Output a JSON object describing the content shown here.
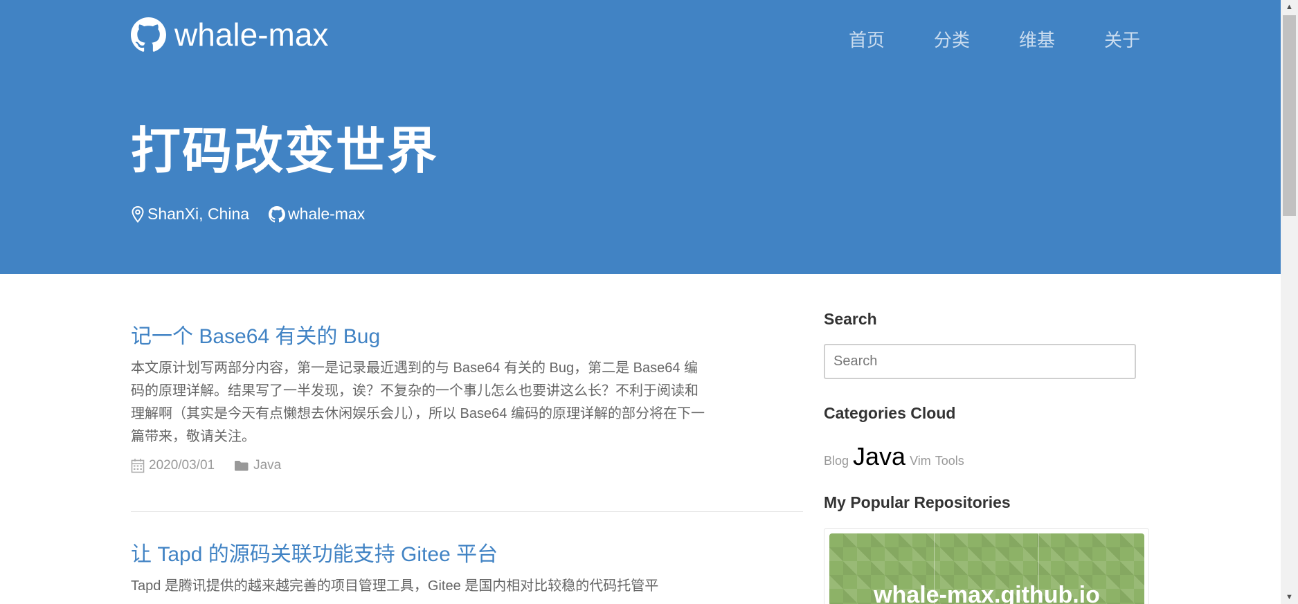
{
  "header": {
    "brand": "whale-max",
    "nav": [
      "首页",
      "分类",
      "维基",
      "关于"
    ],
    "title": "打码改变世界",
    "location": "ShanXi, China",
    "github_user": "whale-max"
  },
  "posts": [
    {
      "title": "记一个 Base64 有关的 Bug",
      "excerpt": "本文原计划写两部分内容，第一是记录最近遇到的与 Base64 有关的 Bug，第二是 Base64 编码的原理详解。结果写了一半发现，诶？不复杂的一个事儿怎么也要讲这么长？不利于阅读和理解啊（其实是今天有点懒想去休闲娱乐会儿），所以 Base64 编码的原理详解的部分将在下一篇带来，敬请关注。",
      "date": "2020/03/01",
      "category": "Java"
    },
    {
      "title": "让 Tapd 的源码关联功能支持 Gitee 平台",
      "excerpt": "Tapd 是腾讯提供的越来越完善的项目管理工具，Gitee 是国内相对比较稳的代码托管平"
    }
  ],
  "sidebar": {
    "search_heading": "Search",
    "search_placeholder": "Search",
    "categories_heading": "Categories Cloud",
    "categories": [
      {
        "name": "Blog"
      },
      {
        "name": "Java"
      },
      {
        "name": "Vim"
      },
      {
        "name": "Tools"
      }
    ],
    "repos_heading": "My Popular Repositories",
    "repo_name": "whale-max.github.io"
  },
  "colors": {
    "header_bg": "#4183c4",
    "link": "#4183c4",
    "repo_card_bg": "#8db267"
  }
}
